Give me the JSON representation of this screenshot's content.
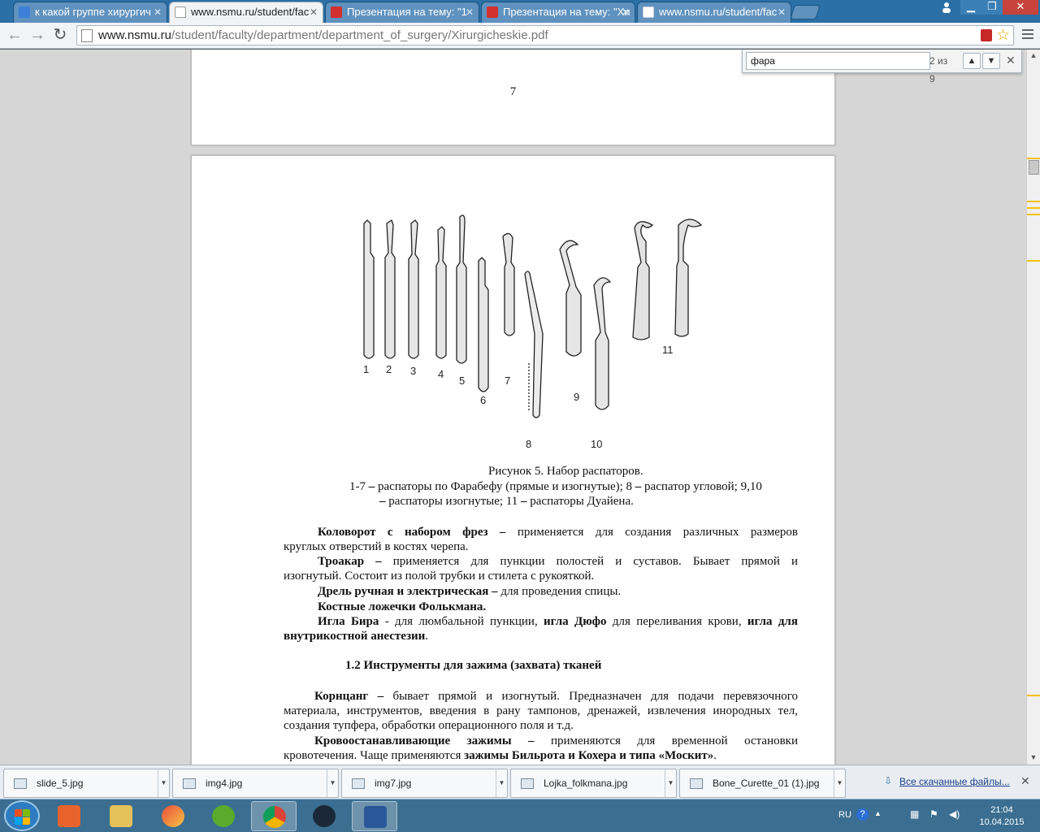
{
  "window": {
    "tabs": [
      {
        "title": "к какой группе хирургич",
        "active": false,
        "icon": "google-icon"
      },
      {
        "title": "www.nsmu.ru/student/fac",
        "active": true,
        "icon": "page-icon"
      },
      {
        "title": "Презентация на тему: \"1",
        "active": false,
        "icon": "presentation-icon"
      },
      {
        "title": "Презентация на тему: \"Хи",
        "active": false,
        "icon": "presentation-icon"
      },
      {
        "title": "www.nsmu.ru/student/fac",
        "active": false,
        "icon": "page-icon"
      }
    ]
  },
  "toolbar": {
    "url_host": "www.nsmu.ru",
    "url_path": "/student/faculty/department/department_of_surgery/Xirurgicheskie.pdf"
  },
  "findbar": {
    "query": "фара",
    "count": "2 из 9"
  },
  "pdf": {
    "page_number": "7",
    "figure_labels": [
      "1",
      "2",
      "3",
      "4",
      "5",
      "6",
      "7",
      "8",
      "9",
      "10",
      "11"
    ],
    "caption_title": "Рисунок 5. Набор распаторов.",
    "caption_line1_a": "1-7 ",
    "caption_line1_b": "–",
    "caption_line1_c": " распаторы по Фарабефу (прямые и изогнутые);  8 ",
    "caption_line1_d": "–",
    "caption_line1_e": " распатор угловой; 9,10",
    "caption_line2_a": "–",
    "caption_line2_b": " распаторы изогнутые;  11 ",
    "caption_line2_c": "–",
    "caption_line2_d": " распаторы Дуайена.",
    "p1_bold": "Коловорот с набором фрез –",
    "p1_rest": " применяется для создания различных размеров",
    "p1_line2": "круглых отверстий в костях черепа.",
    "p2_bold": "Троакар –",
    "p2_rest": " применяется для пункции полостей и суставов. Бывает прямой и",
    "p2_line2": "изогнутый. Состоит из полой трубки и стилета с рукояткой.",
    "p3_bold": "Дрель ручная и электрическая –",
    "p3_rest": " для проведения спицы.",
    "p4_bold": "Костные ложечки Фолькмана.",
    "p5_bold1": "Игла Бира",
    "p5_rest1": "  - для люмбальной пункции, ",
    "p5_bold2": "игла Дюфо",
    "p5_rest2": " для переливания крови, ",
    "p5_bold3": "игла для",
    "p5_bold4": "внутрикостной анестезии",
    "p5_end": ".",
    "section_heading": "1.2   Инструменты для зажима (захвата) тканей",
    "p6_bold": "Корнцанг –",
    "p6_rest": " бывает прямой и изогнутый. Предназначен для подачи перевязочного",
    "p6_line2": "материала, инструментов, введения в рану тампонов, дренажей, извлечения инородных тел,",
    "p6_line3": "создания тупфера, обработки операционного поля и т.д.",
    "p7_bold": "Кровоостанавливающие зажимы –",
    "p7_rest": " применяются для временной остановки",
    "p7_line2a": "кровотечения. Чаще применяются ",
    "p7_line2b": "зажимы Бильрота и Кохера и типа «Москит»",
    "p7_line2c": "."
  },
  "downloads": {
    "items": [
      "slide_5.jpg",
      "img4.jpg",
      "img7.jpg",
      "Lojka_folkmana.jpg",
      "Bone_Curette_01 (1).jpg"
    ],
    "show_all": "Все скачанные файлы..."
  },
  "taskbar": {
    "apps": [
      "media-player-icon",
      "explorer-icon",
      "paint-icon",
      "utorrent-icon",
      "chrome-icon",
      "steam-icon",
      "word-icon"
    ],
    "lang": "RU",
    "time": "21:04",
    "date": "10.04.2015"
  }
}
